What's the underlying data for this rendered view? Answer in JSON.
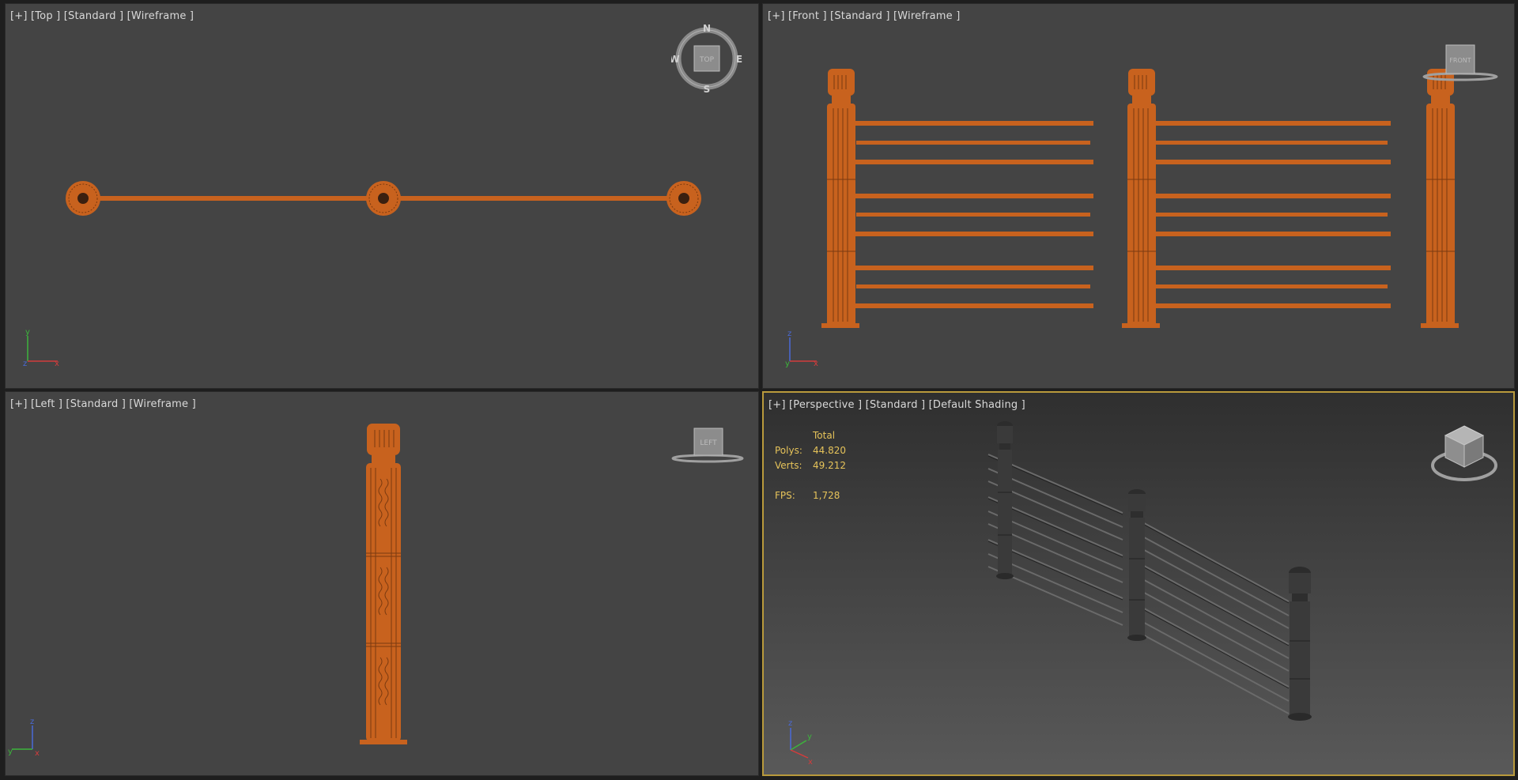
{
  "colors": {
    "wire": "#c8621e",
    "viewport_bg": "#444444",
    "active_border": "#b99a3c",
    "stats_text": "#e6c35a",
    "shaded_object": "#3a3a3a"
  },
  "viewports": {
    "top": {
      "label": "[+] [Top ] [Standard ] [Wireframe ]",
      "cube_label": "TOP",
      "compass": {
        "n": "N",
        "s": "S",
        "e": "E",
        "w": "W"
      }
    },
    "front": {
      "label": "[+] [Front ] [Standard ] [Wireframe ]",
      "cube_label": "FRONT"
    },
    "left": {
      "label": "[+] [Left ] [Standard ] [Wireframe ]",
      "cube_label": "LEFT"
    },
    "perspective": {
      "label": "[+] [Perspective ] [Standard ] [Default Shading ]",
      "stats": {
        "header": "Total",
        "polys_label": "Polys:",
        "polys_value": "44.820",
        "verts_label": "Verts:",
        "verts_value": "49.212",
        "fps_label": "FPS:",
        "fps_value": "1,728"
      }
    }
  },
  "axes": {
    "top": {
      "a": "y",
      "b": "x",
      "c": "z"
    },
    "front": {
      "a": "z",
      "b": "x",
      "c": "y"
    },
    "left": {
      "a": "z",
      "b": "y",
      "c": "x"
    },
    "perspective": {
      "a": "z",
      "b": "y",
      "c": "x"
    }
  }
}
